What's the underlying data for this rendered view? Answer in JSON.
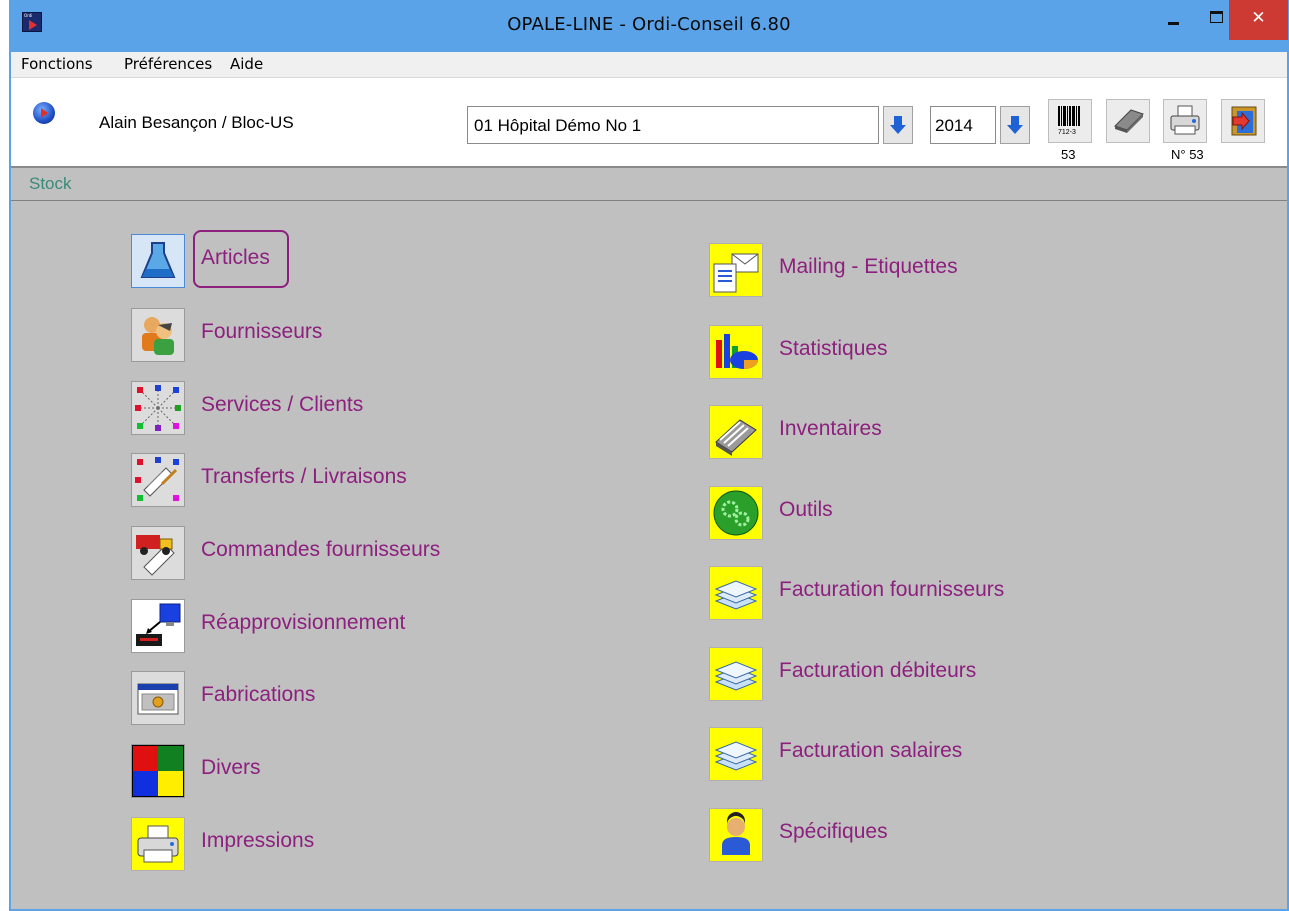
{
  "window": {
    "title": "OPALE-LINE  -  Ordi-Conseil 6.80",
    "close_symbol": "✕"
  },
  "menu": {
    "items": [
      "Fonctions",
      "Préférences",
      "Aide"
    ]
  },
  "toolbar": {
    "user": "Alain Besançon / Bloc-US",
    "site": "01 Hôpital Démo No 1",
    "year": "2014",
    "barcode_caption": "53",
    "print_caption": "N° 53",
    "barcode_digits": "712-3"
  },
  "section": {
    "label": "Stock"
  },
  "left_items": [
    {
      "label": "Articles",
      "icon": "flask-icon",
      "focused": true
    },
    {
      "label": "Fournisseurs",
      "icon": "suppliers-people-icon"
    },
    {
      "label": "Services / Clients",
      "icon": "network-nodes-icon"
    },
    {
      "label": "Transferts / Livraisons",
      "icon": "transfer-icon"
    },
    {
      "label": "Commandes fournisseurs",
      "icon": "delivery-truck-icon"
    },
    {
      "label": "Réapprovisionnement",
      "icon": "monitor-restock-icon"
    },
    {
      "label": "Fabrications",
      "icon": "fabrication-window-icon"
    },
    {
      "label": "Divers",
      "icon": "color-squares-icon"
    },
    {
      "label": "Impressions",
      "icon": "printer-icon"
    }
  ],
  "right_items": [
    {
      "label": "Mailing - Etiquettes",
      "icon": "mailing-envelope-icon"
    },
    {
      "label": "Statistiques",
      "icon": "statistics-chart-icon"
    },
    {
      "label": "Inventaires",
      "icon": "inventory-icon"
    },
    {
      "label": "Outils",
      "icon": "gears-icon"
    },
    {
      "label": "Facturation fournisseurs",
      "icon": "invoice-stack-icon"
    },
    {
      "label": "Facturation débiteurs",
      "icon": "invoice-stack-icon"
    },
    {
      "label": "Facturation salaires",
      "icon": "invoice-stack-icon"
    },
    {
      "label": "Spécifiques",
      "icon": "person-icon"
    }
  ],
  "colors": {
    "titlebar": "#5aa3e8",
    "close": "#cc3a33",
    "label": "#8d1f7e",
    "panel": "#c0c0c0",
    "icon_yellow": "#ffff00"
  }
}
